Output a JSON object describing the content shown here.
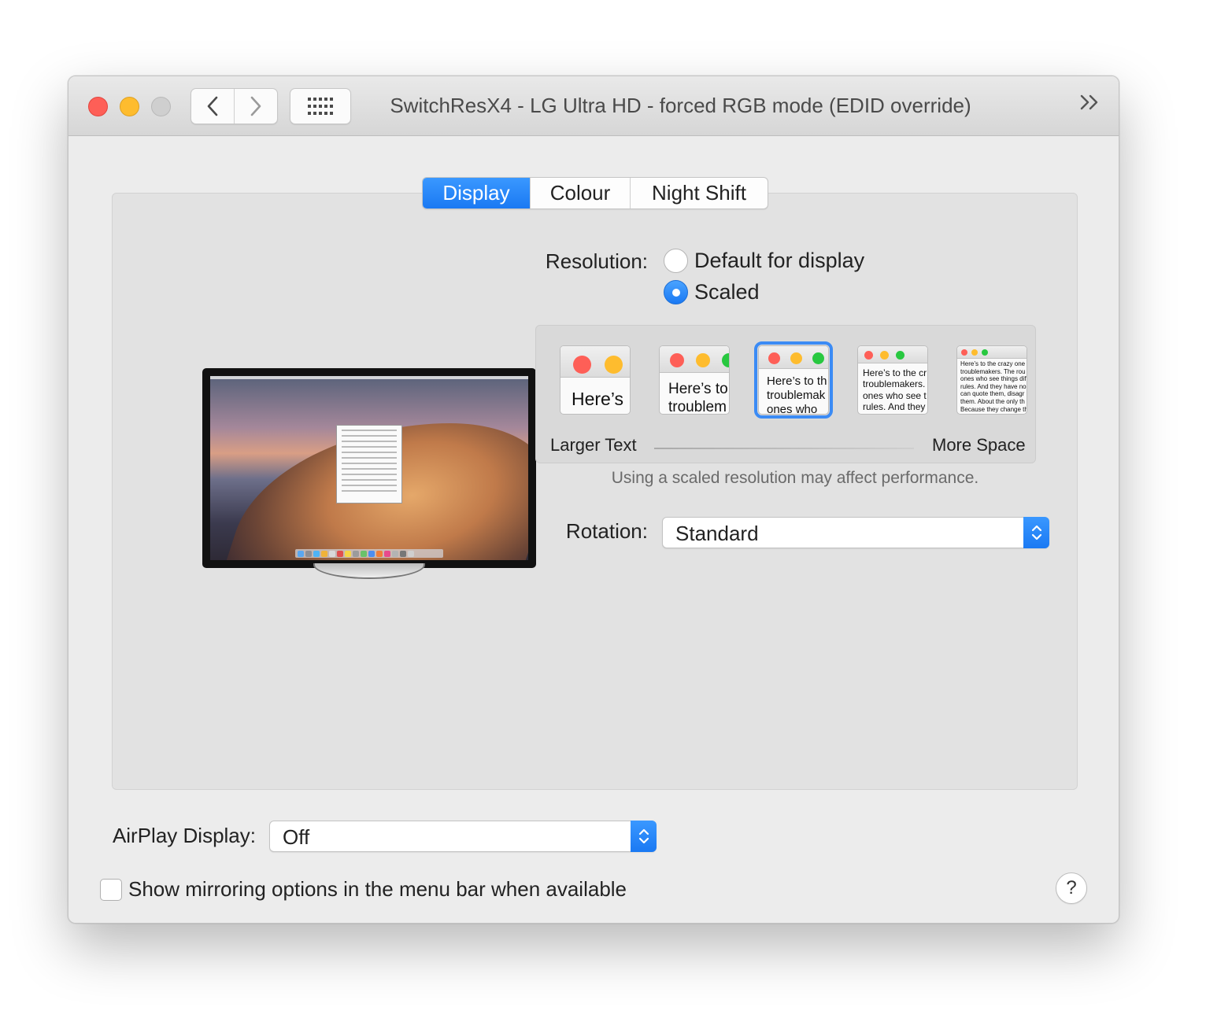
{
  "window": {
    "title": "SwitchResX4 - LG Ultra HD - forced RGB mode (EDID override)"
  },
  "tabs": [
    "Display",
    "Colour",
    "Night Shift"
  ],
  "active_tab": "Display",
  "resolution": {
    "label": "Resolution:",
    "options": [
      "Default for display",
      "Scaled"
    ],
    "selected": "Scaled"
  },
  "scaling": {
    "thumbnails": [
      "Here’s",
      "Here’s to\ntroublem",
      "Here’s to th\ntroublemak\nones who",
      "Here’s to the cr\ntroublemakers.\nones who see t\nrules. And they",
      "Here’s to the crazy one\ntroublemakers. The rou\nones who see things dif\nrules. And they have no\ncan quote them, disagr\nthem. About the only th\nBecause they change th"
    ],
    "selected_index": 2,
    "left_label": "Larger Text",
    "right_label": "More Space",
    "note": "Using a scaled resolution may affect performance."
  },
  "rotation": {
    "label": "Rotation:",
    "value": "Standard"
  },
  "airplay": {
    "label": "AirPlay Display:",
    "value": "Off"
  },
  "mirroring": {
    "label": "Show mirroring options in the menu bar when available",
    "checked": false
  },
  "help": {
    "label": "?"
  },
  "colors": {
    "accent": "#1a79f3",
    "close": "#fe5f57",
    "minimize": "#febc2e",
    "zoom_disabled": "#cfcfcf"
  }
}
